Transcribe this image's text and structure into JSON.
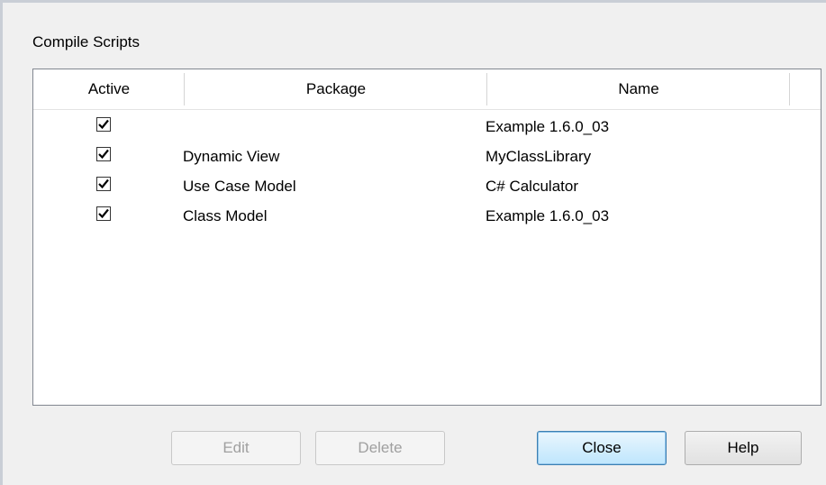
{
  "dialog": {
    "title": "Compile Scripts"
  },
  "table": {
    "columns": [
      "Active",
      "Package",
      "Name"
    ],
    "rows": [
      {
        "active": true,
        "package": "",
        "name": "Example 1.6.0_03"
      },
      {
        "active": true,
        "package": "Dynamic View",
        "name": "MyClassLibrary"
      },
      {
        "active": true,
        "package": "Use Case Model",
        "name": "C# Calculator"
      },
      {
        "active": true,
        "package": "Class Model",
        "name": "Example 1.6.0_03"
      }
    ]
  },
  "buttons": {
    "edit": {
      "label": "Edit",
      "enabled": false
    },
    "delete": {
      "label": "Delete",
      "enabled": false
    },
    "close": {
      "label": "Close",
      "enabled": true,
      "default": true
    },
    "help": {
      "label": "Help",
      "enabled": true
    }
  }
}
